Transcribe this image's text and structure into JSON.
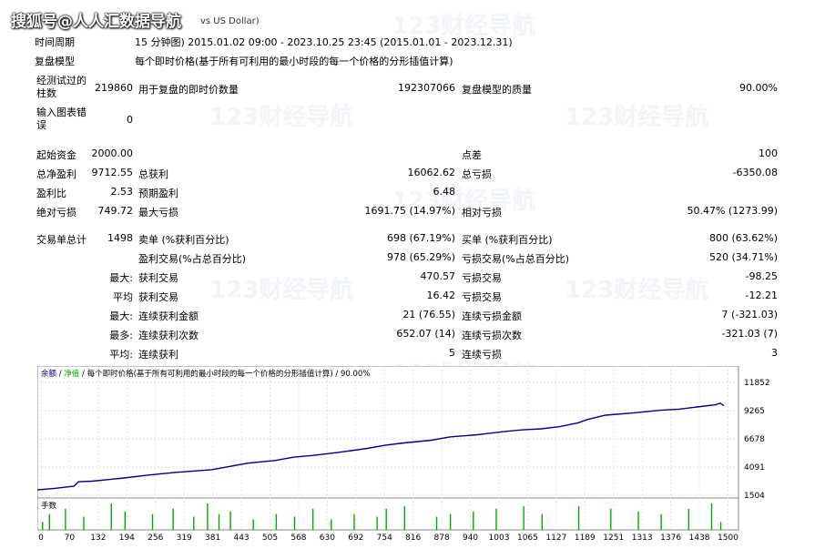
{
  "header": {
    "brand": "搜狐号@人人汇数据导航",
    "symbol": "vs US Dollar)"
  },
  "watermark": "123财经导航",
  "rows": {
    "period_label": "时间周期",
    "period_value": "15 分钟图) 2015.01.02 09:00 - 2023.10.25 23:45 (2015.01.01 - 2023.12.31)",
    "model_label": "复盘模型",
    "model_value": "每个即时价格(基于所有可利用的最小时段的每一个价格的分形插值计算)",
    "bars_label": "经测试过的柱数",
    "bars_value": "219860",
    "ticks_label": "用于复盘的即时价数量",
    "ticks_value": "192307066",
    "quality_label": "复盘模型的质量",
    "quality_value": "90.00%",
    "errors_label": "输入图表错误",
    "errors_value": "0",
    "deposit_label": "起始资金",
    "deposit_value": "2000.00",
    "spread_label": "点差",
    "spread_value": "100",
    "netprofit_label": "总净盈利",
    "netprofit_value": "9712.55",
    "grossprofit_label": "总获利",
    "grossprofit_value": "16062.62",
    "grossloss_label": "总亏损",
    "grossloss_value": "-6350.08",
    "pf_label": "盈利比",
    "pf_value": "2.53",
    "payoff_label": "预期盈利",
    "payoff_value": "6.48",
    "absdd_label": "绝对亏损",
    "absdd_value": "749.72",
    "maxdd_label": "最大亏损",
    "maxdd_value": "1691.75 (14.97%)",
    "reldd_label": "相对亏损",
    "reldd_value": "50.47% (1273.99)",
    "trades_label": "交易单总计",
    "trades_value": "1498",
    "short_label": "卖单 (%获利百分比)",
    "short_value": "698 (67.19%)",
    "long_label": "买单 (%获利百分比)",
    "long_value": "800 (63.62%)",
    "wins_label": "盈利交易(%占总百分比)",
    "wins_value": "978 (65.29%)",
    "losses_label": "亏损交易(%占总百分比)",
    "losses_value": "520 (34.71%)",
    "largest_prefix": "最大:",
    "largest_win_label": "获利交易",
    "largest_win_value": "470.57",
    "largest_loss_label": "亏损交易",
    "largest_loss_value": "-98.25",
    "average_prefix": "平均",
    "avg_win_label": "获利交易",
    "avg_win_value": "16.42",
    "avg_loss_label": "亏损交易",
    "avg_loss_value": "-12.21",
    "max_prefix": "最大:",
    "consec_win_amt_label": "连续获利金额",
    "consec_win_amt_value": "21 (76.55)",
    "consec_loss_amt_label": "连续亏损金额",
    "consec_loss_amt_value": "7 (-321.03)",
    "most_prefix": "最多:",
    "consec_win_cnt_label": "连续获利次数",
    "consec_win_cnt_value": "652.07 (14)",
    "consec_loss_cnt_label": "连续亏损次数",
    "consec_loss_cnt_value": "-321.03 (7)",
    "avg_prefix": "平均:",
    "avg_consec_win_label": "连续获利",
    "avg_consec_win_value": "5",
    "avg_consec_loss_label": "连续亏损",
    "avg_consec_loss_value": "3"
  },
  "chart_data": {
    "type": "line",
    "title_balance": "余额",
    "title_sep1": " / ",
    "title_equity": "净值",
    "title_rest": " / 每个即时价格(基于所有可利用的最小时段的每一个价格的分形插值计算) / 90.00%",
    "volume_label": "手数",
    "y_ticks": [
      "11852",
      "9265",
      "6678",
      "4091",
      "1504"
    ],
    "ylim": [
      1504,
      11852
    ],
    "x_ticks": [
      "0",
      "70",
      "132",
      "194",
      "256",
      "319",
      "381",
      "443",
      "505",
      "568",
      "630",
      "692",
      "754",
      "816",
      "878",
      "940",
      "1003",
      "1065",
      "1127",
      "1189",
      "1251",
      "1313",
      "1376",
      "1438",
      "1500"
    ],
    "xlim": [
      0,
      1530
    ],
    "series": [
      {
        "color": "#00008b",
        "x": [
          0,
          40,
          80,
          90,
          120,
          180,
          240,
          300,
          380,
          420,
          460,
          520,
          560,
          600,
          660,
          720,
          760,
          800,
          860,
          900,
          960,
          980,
          1020,
          1060,
          1100,
          1140,
          1180,
          1200,
          1240,
          1300,
          1360,
          1400,
          1440,
          1480,
          1490,
          1498
        ],
        "values": [
          2000,
          2150,
          2350,
          2750,
          2800,
          3050,
          3350,
          3600,
          3850,
          4150,
          4450,
          4700,
          5000,
          5150,
          5450,
          5800,
          6100,
          6300,
          6550,
          6850,
          7050,
          7150,
          7350,
          7500,
          7600,
          7800,
          8150,
          8450,
          8850,
          9050,
          9300,
          9400,
          9600,
          9800,
          9950,
          9712
        ]
      }
    ],
    "volume": {
      "color": "#00aa00",
      "x": [
        10,
        25,
        60,
        100,
        160,
        190,
        250,
        295,
        340,
        370,
        395,
        420,
        470,
        520,
        560,
        600,
        640,
        690,
        740,
        760,
        800,
        870,
        900,
        950,
        1000,
        1060,
        1100,
        1180,
        1250,
        1310,
        1360,
        1420,
        1470,
        1490
      ],
      "values": [
        0.3,
        0.6,
        0.8,
        0.5,
        1.0,
        0.7,
        0.6,
        0.8,
        0.5,
        1.0,
        0.6,
        0.7,
        0.4,
        0.6,
        0.5,
        0.8,
        0.4,
        0.6,
        0.5,
        0.8,
        0.9,
        0.5,
        0.6,
        0.7,
        0.8,
        0.9,
        0.6,
        0.9,
        0.8,
        0.7,
        0.6,
        0.8,
        1.0,
        0.3
      ]
    }
  }
}
